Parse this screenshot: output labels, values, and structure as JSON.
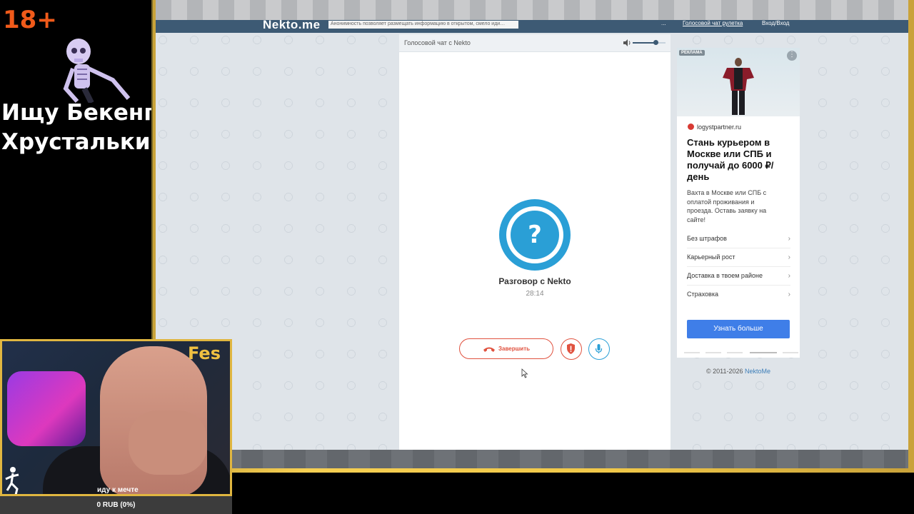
{
  "overlay": {
    "age_rating": "18+",
    "stream_title_line1": "Ищу Бекенг",
    "stream_title_line2": "Хрустальки"
  },
  "site": {
    "logo": "Nekto.me",
    "notice": "Анонимность позволяет размещать информацию в открытом, смело иди…",
    "nav": [
      "...",
      "Голосовой чат рулетка",
      "Вход/Вход"
    ]
  },
  "chat": {
    "header_title": "Голосовой чат с Nekto",
    "volume_level": 0.7,
    "avatar_glyph": "?",
    "peer_name": "Разговор с Nekto",
    "timer": "28:14",
    "end_button_label": "Завершить",
    "report_icon": "shield-alert-icon",
    "mic_icon": "microphone-icon"
  },
  "ad": {
    "badge": "РЕКЛАМА",
    "menu_glyph": "⋮",
    "domain": "logystpartner.ru",
    "headline": "Стань курьером в Москве или СПБ и получай до 6000 ₽/день",
    "description": "Вахта в Москве или СПБ с оплатой проживания и проезда. Оставь заявку на сайте!",
    "items": [
      "Без штрафов",
      "Карьерный рост",
      "Доставка в твоем районе",
      "Страховка"
    ],
    "cta": "Узнать больше"
  },
  "footer": {
    "copyright": "© 2011-2026",
    "link": "NektoMe"
  },
  "webcam": {
    "corner_label": "Fes",
    "caption": "иду к мечте",
    "donation": "0 RUB (0%)"
  },
  "colors": {
    "nekto_blue": "#2a9fd6",
    "end_red": "#e0523f",
    "nav_dark": "#3d5a74",
    "frame_gold": "#f0c849",
    "ad_cta": "#3f7ee8"
  }
}
